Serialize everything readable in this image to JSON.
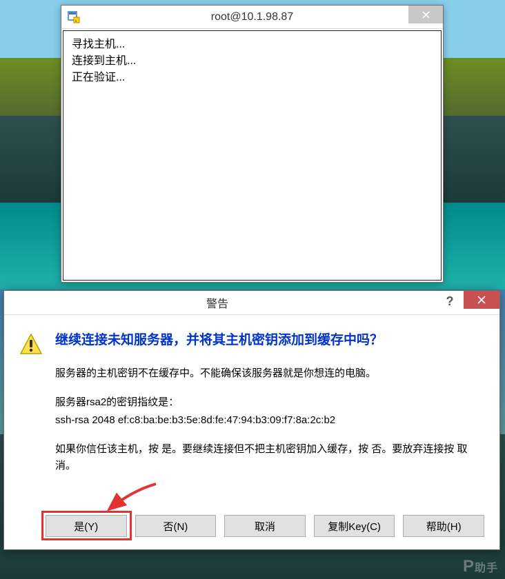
{
  "terminal": {
    "title": "root@10.1.98.87",
    "lines": [
      "寻找主机...",
      "连接到主机...",
      "正在验证..."
    ]
  },
  "warning": {
    "title": "警告",
    "help_symbol": "?",
    "heading": "继续连接未知服务器，并将其主机密钥添加到缓存中吗？",
    "para1": "服务器的主机密钥不在缓存中。不能确保该服务器就是你想连的电脑。",
    "para2_line1": "服务器rsa2的密钥指纹是：",
    "para2_line2": "ssh-rsa 2048 ef:c8:ba:be:b3:5e:8d:fe:47:94:b3:09:f7:8a:2c:b2",
    "para3": "如果你信任该主机，按 是。要继续连接但不把主机密钥加入缓存，按 否。要放弃连接按 取消。",
    "buttons": {
      "yes": "是(Y)",
      "no": "否(N)",
      "cancel": "取消",
      "copy": "复制Key(C)",
      "help": "帮助(H)"
    }
  },
  "watermark": {
    "logo": "P",
    "text": "助手"
  }
}
